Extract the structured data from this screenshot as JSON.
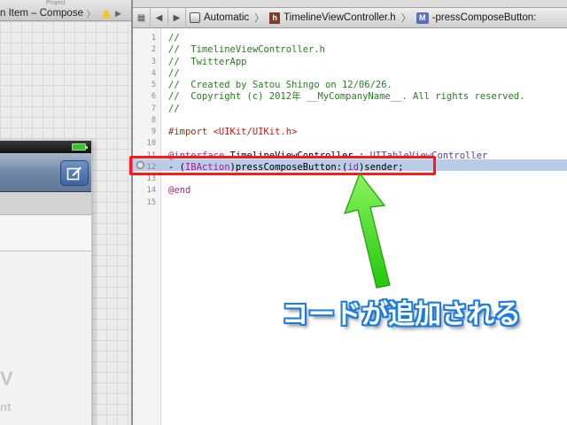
{
  "left_pane": {
    "project_label": "Project",
    "breadcrumb_text": "n Item – Compose",
    "breadcrumb_sep": "〉",
    "forward_arrow": "▶",
    "ghost_text_1": "V",
    "ghost_text_2": "nt"
  },
  "jump_bar": {
    "back_arrow": "◀",
    "forward_arrow": "▶",
    "mode": "Automatic",
    "file": "TimelineViewController.h",
    "file_icon_letter": "h",
    "method_icon_letter": "M",
    "method": "-pressComposeButton:",
    "separator": "〉"
  },
  "code_lines": [
    {
      "n": "1",
      "tokens": [
        {
          "t": "//",
          "c": "c-comment"
        }
      ]
    },
    {
      "n": "2",
      "tokens": [
        {
          "t": "//  TimelineViewController.h",
          "c": "c-comment"
        }
      ]
    },
    {
      "n": "3",
      "tokens": [
        {
          "t": "//  TwitterApp",
          "c": "c-comment"
        }
      ]
    },
    {
      "n": "4",
      "tokens": [
        {
          "t": "//",
          "c": "c-comment"
        }
      ]
    },
    {
      "n": "5",
      "tokens": [
        {
          "t": "//  Created by Satou Shingo on 12/06/26.",
          "c": "c-comment"
        }
      ]
    },
    {
      "n": "6",
      "tokens": [
        {
          "t": "//  Copyright (c) 2012年 __MyCompanyName__. All rights reserved.",
          "c": "c-comment"
        }
      ]
    },
    {
      "n": "7",
      "tokens": [
        {
          "t": "//",
          "c": "c-comment"
        }
      ]
    },
    {
      "n": "8",
      "tokens": []
    },
    {
      "n": "9",
      "tokens": [
        {
          "t": "#import ",
          "c": "c-pre"
        },
        {
          "t": "<UIKit/UIKit.h>",
          "c": "c-str"
        }
      ]
    },
    {
      "n": "10",
      "tokens": []
    },
    {
      "n": "11",
      "tokens": [
        {
          "t": "@interface",
          "c": "c-kw"
        },
        {
          "t": " TimelineViewController : ",
          "c": "c-plain"
        },
        {
          "t": "UITableViewController",
          "c": "c-type"
        }
      ]
    },
    {
      "n": "12",
      "tokens": [
        {
          "t": "- (",
          "c": "c-plain"
        },
        {
          "t": "IBAction",
          "c": "c-kw"
        },
        {
          "t": ")pressComposeButton:(",
          "c": "c-plain"
        },
        {
          "t": "id",
          "c": "c-kw"
        },
        {
          "t": ")sender;",
          "c": "c-plain"
        }
      ]
    },
    {
      "n": "13",
      "tokens": []
    },
    {
      "n": "14",
      "tokens": [
        {
          "t": "@end",
          "c": "c-kw"
        }
      ]
    },
    {
      "n": "15",
      "tokens": []
    }
  ],
  "annotation": {
    "text": "コードが追加される",
    "arrow_color": "#3ee51c"
  },
  "colors": {
    "highlight_box": "#ff1a1a",
    "selected_line": "#b9cce8"
  }
}
